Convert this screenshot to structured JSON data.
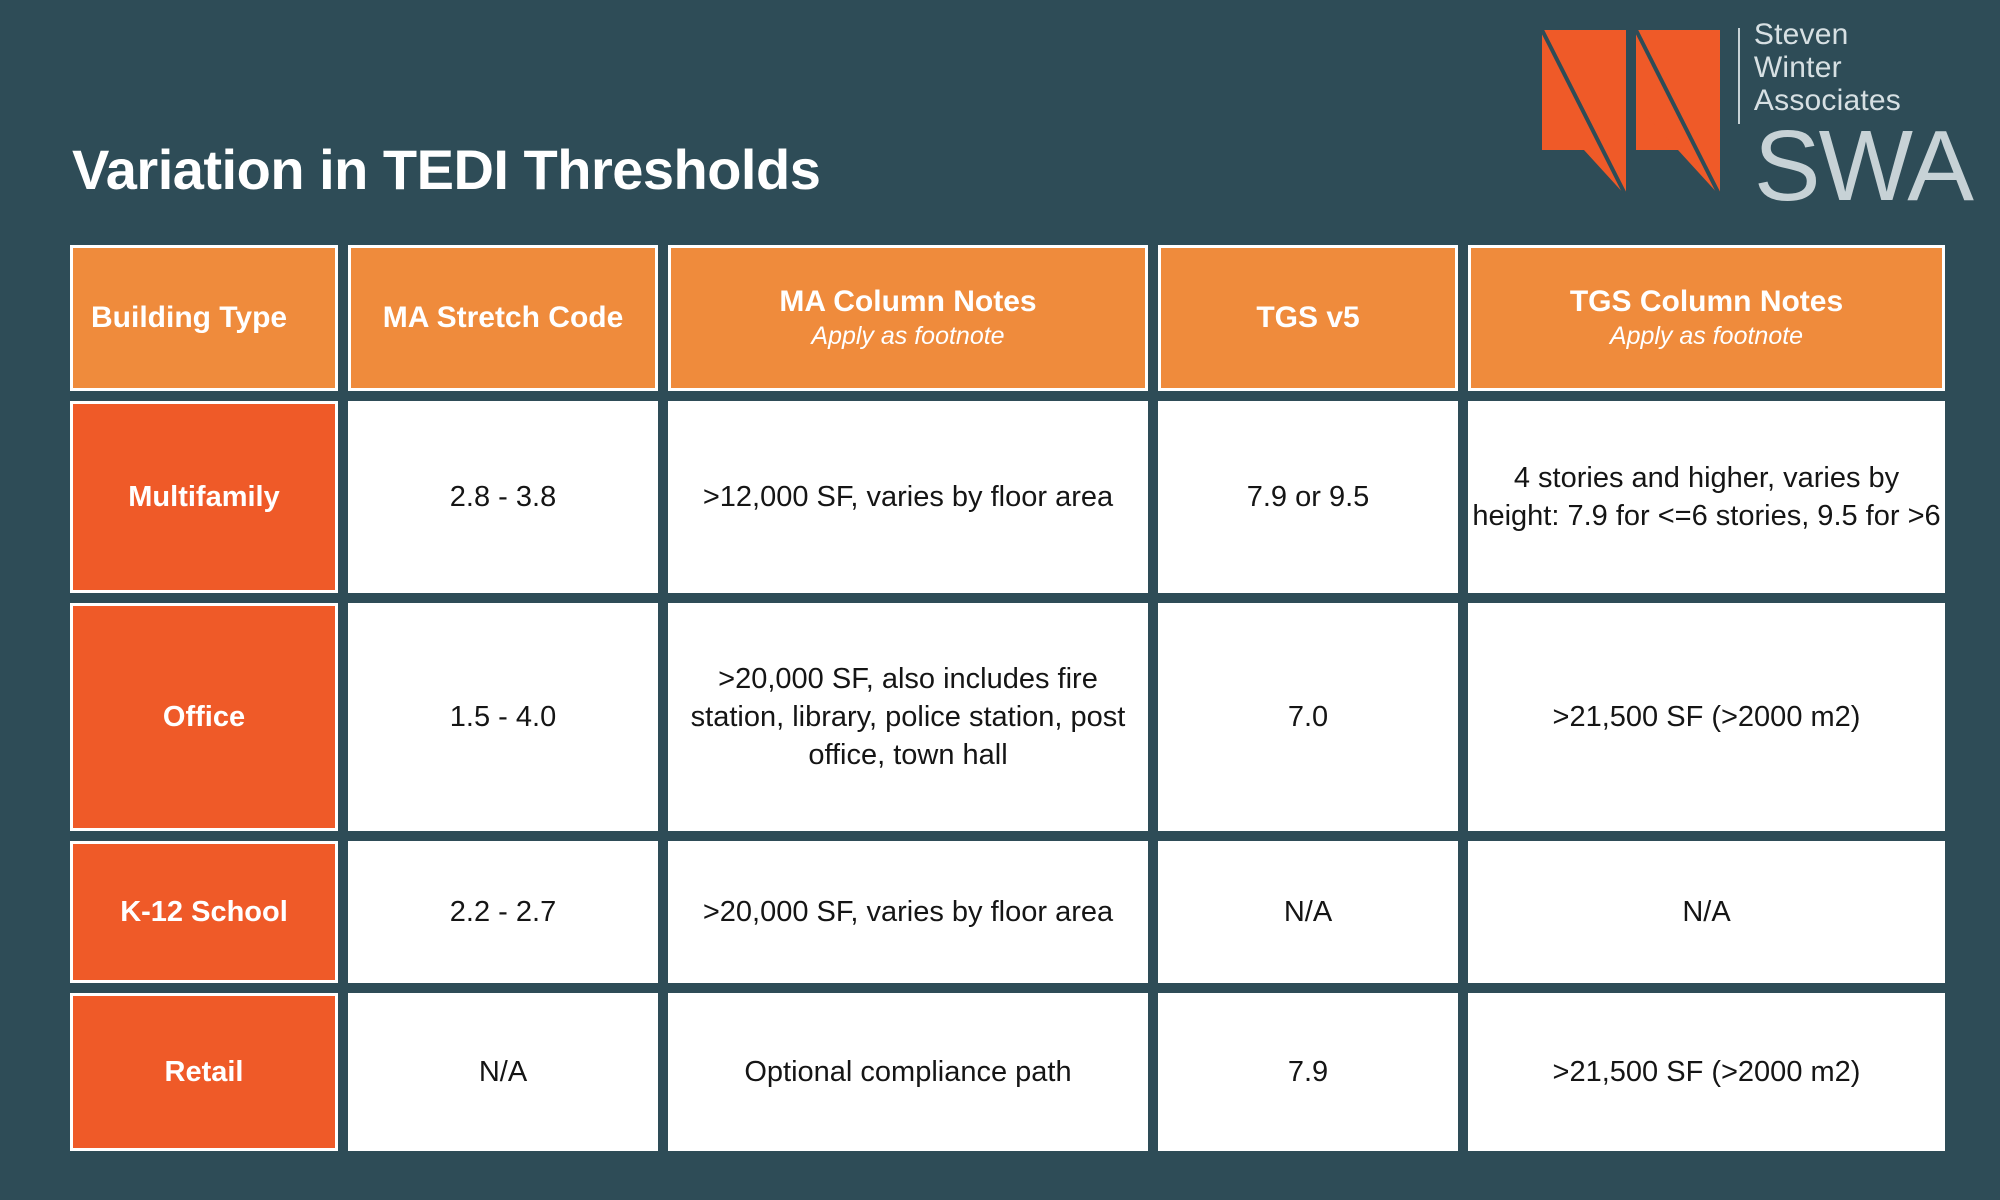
{
  "slide": {
    "title": "Variation in TEDI Thresholds",
    "background_color": "#2e4c57"
  },
  "logo": {
    "company_line1": "Steven",
    "company_line2": "Winter",
    "company_line3": "Associates",
    "acronym": "SWA",
    "mark_color": "#ef5a28",
    "text_color": "#d7e0e3"
  },
  "table": {
    "header_bg": "#ef8b3c",
    "rowlabel_bg": "#ef5a28",
    "headers": [
      {
        "main": "Building Type",
        "sub": ""
      },
      {
        "main": "MA Stretch Code",
        "sub": ""
      },
      {
        "main": "MA Column Notes",
        "sub": "Apply as footnote"
      },
      {
        "main": "TGS v5",
        "sub": ""
      },
      {
        "main": "TGS Column Notes",
        "sub": "Apply as footnote"
      }
    ],
    "rows": [
      {
        "building_type": "Multifamily",
        "ma_stretch_code": "2.8 - 3.8",
        "ma_column_notes": ">12,000 SF, varies by floor area",
        "tgs_v5": "7.9 or 9.5",
        "tgs_column_notes": "4 stories and higher, varies by height: 7.9 for <=6 stories, 9.5 for >6"
      },
      {
        "building_type": "Office",
        "ma_stretch_code": "1.5 - 4.0",
        "ma_column_notes": ">20,000 SF, also includes fire station, library, police station, post office, town hall",
        "tgs_v5": "7.0",
        "tgs_column_notes": ">21,500 SF (>2000 m2)"
      },
      {
        "building_type": "K-12 School",
        "ma_stretch_code": "2.2 - 2.7",
        "ma_column_notes": ">20,000 SF, varies by floor area",
        "tgs_v5": "N/A",
        "tgs_column_notes": "N/A"
      },
      {
        "building_type": "Retail",
        "ma_stretch_code": "N/A",
        "ma_column_notes": "Optional compliance path",
        "tgs_v5": "7.9",
        "tgs_column_notes": ">21,500 SF (>2000 m2)"
      }
    ]
  }
}
